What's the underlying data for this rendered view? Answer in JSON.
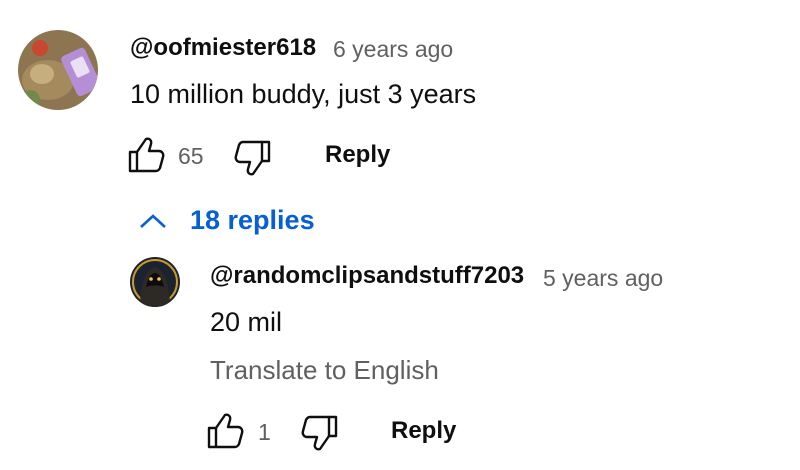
{
  "comment": {
    "author": "@oofmiester618",
    "time": "6 years ago",
    "text": "10 million buddy, just 3 years",
    "like_count": "65",
    "reply_label": "Reply",
    "avatar_icon": "avatar-photo"
  },
  "replies_toggle": {
    "label": "18 replies",
    "icon": "chevron-up-icon",
    "color": "#065fd4"
  },
  "reply": {
    "author": "@randomclipsandstuff7203",
    "time": "5 years ago",
    "text": "20 mil",
    "translate_label": "Translate to English",
    "like_count": "1",
    "reply_label": "Reply",
    "avatar_icon": "hooded-figure-avatar"
  }
}
